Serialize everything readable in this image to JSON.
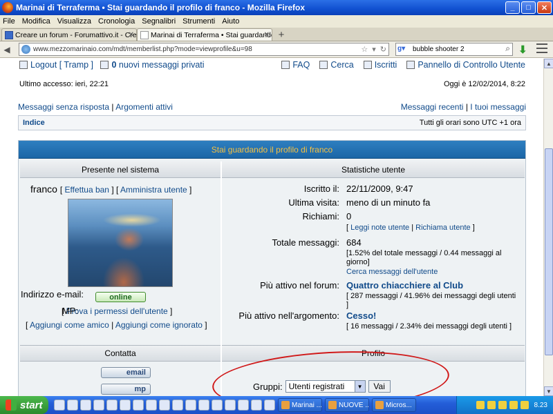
{
  "window": {
    "title": "Marinai di Terraferma • Stai guardando il profilo di franco - Mozilla Firefox"
  },
  "menubar": [
    "File",
    "Modifica",
    "Visualizza",
    "Cronologia",
    "Segnalibri",
    "Strumenti",
    "Aiuto"
  ],
  "tabs": [
    {
      "label": "Creare un forum - Forumattivo.it - Crear...",
      "active": false
    },
    {
      "label": "Marinai di Terraferma • Stai guardando il ...",
      "active": true
    }
  ],
  "nav": {
    "url": "www.mezzomarinaio.com/mdt/memberlist.php?mode=viewprofile&u=98",
    "search": "bubble shooter 2"
  },
  "forum": {
    "logout": "Logout [ Tramp ]",
    "messages_count": "0",
    "messages_label": "nuovi messaggi privati",
    "faq": "FAQ",
    "search": "Cerca",
    "members": "Iscritti",
    "ucp": "Pannello di Controllo Utente",
    "last_access": "Ultimo accesso: ieri, 22:21",
    "today": "Oggi è 12/02/2014, 8:22",
    "unanswered": "Messaggi senza risposta",
    "sep1": " | ",
    "active_topics": "Argomenti attivi",
    "recent": "Messaggi recenti",
    "sep2": " | ",
    "your_posts": "I tuoi messaggi",
    "index": "Indice",
    "timezone": "Tutti gli orari sono UTC +1 ora"
  },
  "profile": {
    "header": "Stai guardando il profilo di franco",
    "col_left": "Presente nel sistema",
    "col_right": "Statistiche utente",
    "username": "franco",
    "ban_link": "Effettua ban",
    "admin_link": "Amministra utente",
    "online": "online",
    "perm_link": "Prova i permessi dell'utente",
    "add_friend": "Aggiungi come amico",
    "add_ignore": "Aggiungi come ignorato",
    "joined_label": "Iscritto il:",
    "joined_value": "22/11/2009, 9:47",
    "last_visit_label": "Ultima visita:",
    "last_visit_value": "meno di un minuto fa",
    "warnings_label": "Richiami:",
    "warnings_value": "0",
    "read_notes": "Leggi note utente",
    "warn_user": "Richiama utente",
    "total_posts_label": "Totale messaggi:",
    "total_posts_value": "684",
    "total_posts_note": "[1.52% del totale messaggi / 0.44 messaggi al giorno]",
    "search_posts": "Cerca messaggi dell'utente",
    "active_forum_label": "Più attivo nel forum:",
    "active_forum_value": "Quattro chiacchiere al Club",
    "active_forum_note": "[ 287 messaggi / 41.96% dei messaggi degli utenti ]",
    "active_topic_label": "Più attivo nell'argomento:",
    "active_topic_value": "Cesso!",
    "active_topic_note": "[ 16 messaggi / 2.34% dei messaggi degli utenti ]",
    "contact_header": "Contatta",
    "profile_header": "Profilo",
    "email_label": "Indirizzo e-mail:",
    "email_btn": "email",
    "pm_label": "MP:",
    "pm_btn": "mp",
    "groups_label": "Gruppi:",
    "groups_value": "Utenti registrati",
    "go_btn": "Vai"
  },
  "taskbar": {
    "start": "start",
    "items": [
      "Marinai ...",
      "NUOVE ...",
      "Micros..."
    ],
    "clock": "8.23"
  },
  "colors": {
    "header_blue": "#1b66a6",
    "header_text": "#f6c040",
    "link": "#104a8a",
    "annotation_red": "#d01818"
  }
}
